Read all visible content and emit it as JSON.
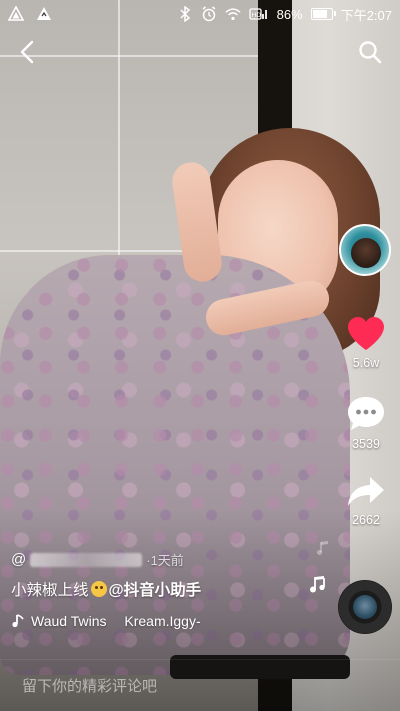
{
  "status_bar": {
    "battery_percent": "86%",
    "time": "下午2:07",
    "icons": [
      "app-icon-1",
      "app-icon-2",
      "bluetooth-icon",
      "alarm-icon",
      "wifi-icon",
      "volte-icon"
    ]
  },
  "nav": {
    "back_icon": "chevron-left-icon",
    "search_icon": "search-icon"
  },
  "actions": {
    "like_count": "5.6w",
    "comment_count": "3539",
    "share_count": "2662"
  },
  "post": {
    "author_prefix": "@",
    "time_ago": "·1天前",
    "caption_text": "小辣椒上线",
    "mention": "@抖音小助手",
    "music_artist": "Waud Twins",
    "music_track": "Kream.Iggy-"
  },
  "comment_box": {
    "placeholder": "留下你的精彩评论吧"
  },
  "colors": {
    "like_red": "#fe2c55",
    "white": "#ffffff"
  }
}
